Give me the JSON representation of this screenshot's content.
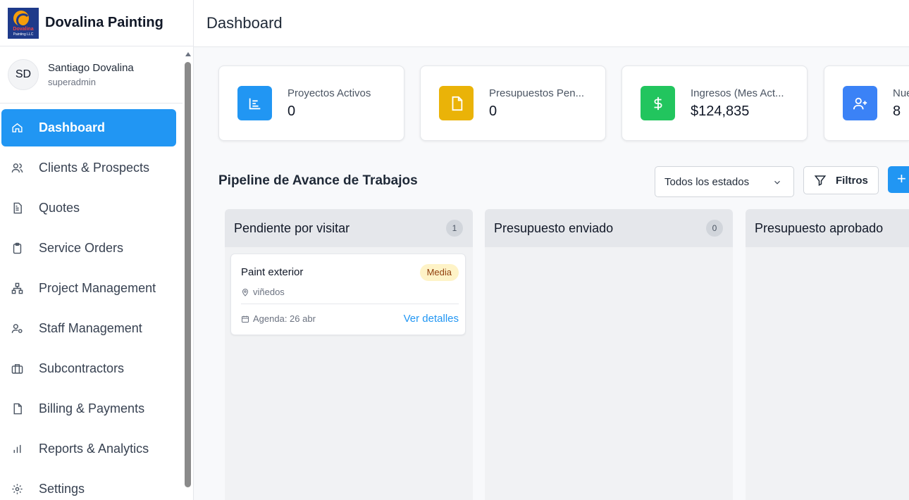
{
  "brand": {
    "name": "Dovalina Painting",
    "logo_line1": "Dovalina",
    "logo_line2": "Painting LLC"
  },
  "user": {
    "initials": "SD",
    "name": "Santiago Dovalina",
    "role": "superadmin"
  },
  "nav": {
    "items": [
      {
        "label": "Dashboard",
        "icon": "home-icon",
        "active": true
      },
      {
        "label": "Clients & Prospects",
        "icon": "users-icon"
      },
      {
        "label": "Quotes",
        "icon": "document-icon"
      },
      {
        "label": "Service Orders",
        "icon": "clipboard-icon"
      },
      {
        "label": "Project Management",
        "icon": "hierarchy-icon"
      },
      {
        "label": "Staff Management",
        "icon": "user-gear-icon"
      },
      {
        "label": "Subcontractors",
        "icon": "briefcase-icon"
      },
      {
        "label": "Billing & Payments",
        "icon": "file-icon"
      },
      {
        "label": "Reports & Analytics",
        "icon": "bar-chart-icon"
      },
      {
        "label": "Settings",
        "icon": "gear-icon"
      }
    ]
  },
  "header": {
    "title": "Dashboard"
  },
  "stats": [
    {
      "label": "Proyectos Activos",
      "value": "0",
      "color": "#2196f3",
      "icon": "chart-icon"
    },
    {
      "label": "Presupuestos Pen...",
      "value": "0",
      "color": "#eab308",
      "icon": "document-icon"
    },
    {
      "label": "Ingresos (Mes Act...",
      "value": "$124,835",
      "color": "#22c55e",
      "icon": "dollar-icon"
    },
    {
      "label": "Nue",
      "value": "8",
      "color": "#3b82f6",
      "icon": "user-plus-icon"
    }
  ],
  "pipeline": {
    "title": "Pipeline de Avance de Trabajos",
    "filter_select": "Todos los estados",
    "filter_button": "Filtros",
    "add_button": "+",
    "columns": [
      {
        "title": "Pendiente por visitar",
        "count": "1",
        "cards": [
          {
            "title": "Paint exterior",
            "priority": "Media",
            "location": "viñedos",
            "schedule": "Agenda: 26 abr",
            "link": "Ver detalles"
          }
        ]
      },
      {
        "title": "Presupuesto enviado",
        "count": "0",
        "cards": []
      },
      {
        "title": "Presupuesto aprobado",
        "count": "",
        "cards": []
      }
    ]
  }
}
